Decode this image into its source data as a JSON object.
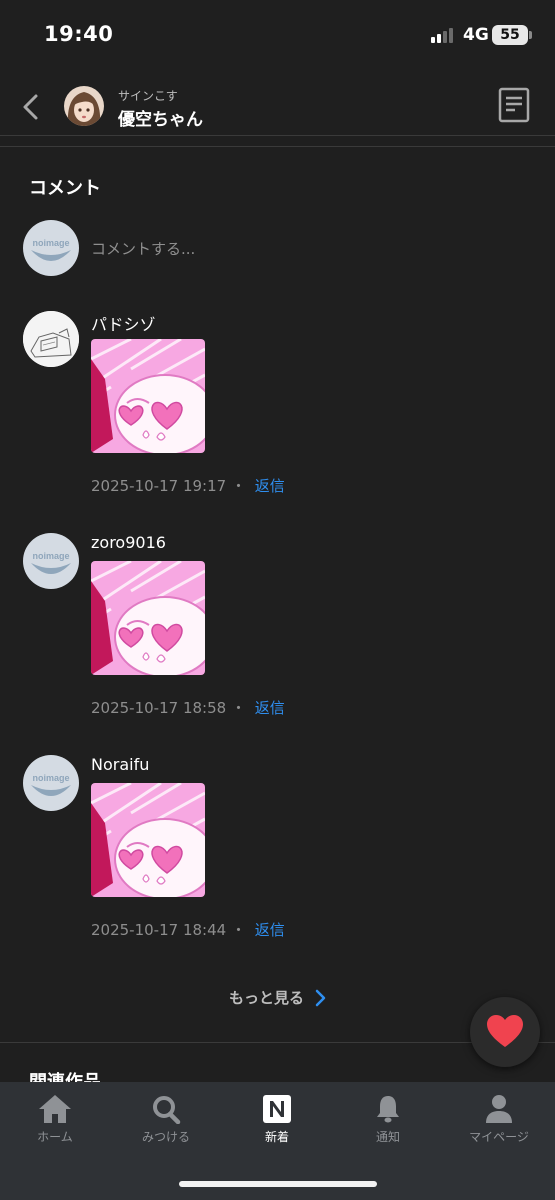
{
  "status_bar": {
    "time": "19:40",
    "network": "4G",
    "battery": "55"
  },
  "header": {
    "subtitle": "サインこす",
    "title": "優空ちゃん"
  },
  "comments_section": {
    "title": "コメント",
    "input_placeholder": "コメントする...",
    "comments": [
      {
        "user": "パドシゾ",
        "timestamp": "2025-10-17 19:17",
        "reply": "返信"
      },
      {
        "user": "zoro9016",
        "timestamp": "2025-10-17 18:58",
        "reply": "返信"
      },
      {
        "user": "Noraifu",
        "timestamp": "2025-10-17 18:44",
        "reply": "返信"
      }
    ],
    "separator": " ・ ",
    "more_label": "もっと見る"
  },
  "related_title": "関連作品",
  "no_image_text": "noimage",
  "tabs": [
    {
      "label": "ホーム",
      "icon": "home-icon"
    },
    {
      "label": "みつける",
      "icon": "search-icon"
    },
    {
      "label": "新着",
      "icon": "new-n-icon"
    },
    {
      "label": "通知",
      "icon": "bell-icon"
    },
    {
      "label": "マイページ",
      "icon": "person-icon"
    }
  ],
  "colors": {
    "background": "#1f1f1f",
    "tabbar": "#2f3236",
    "link": "#2f8ff0",
    "heart": "#f0434f",
    "stamp_pink": "#f7a8e2"
  }
}
